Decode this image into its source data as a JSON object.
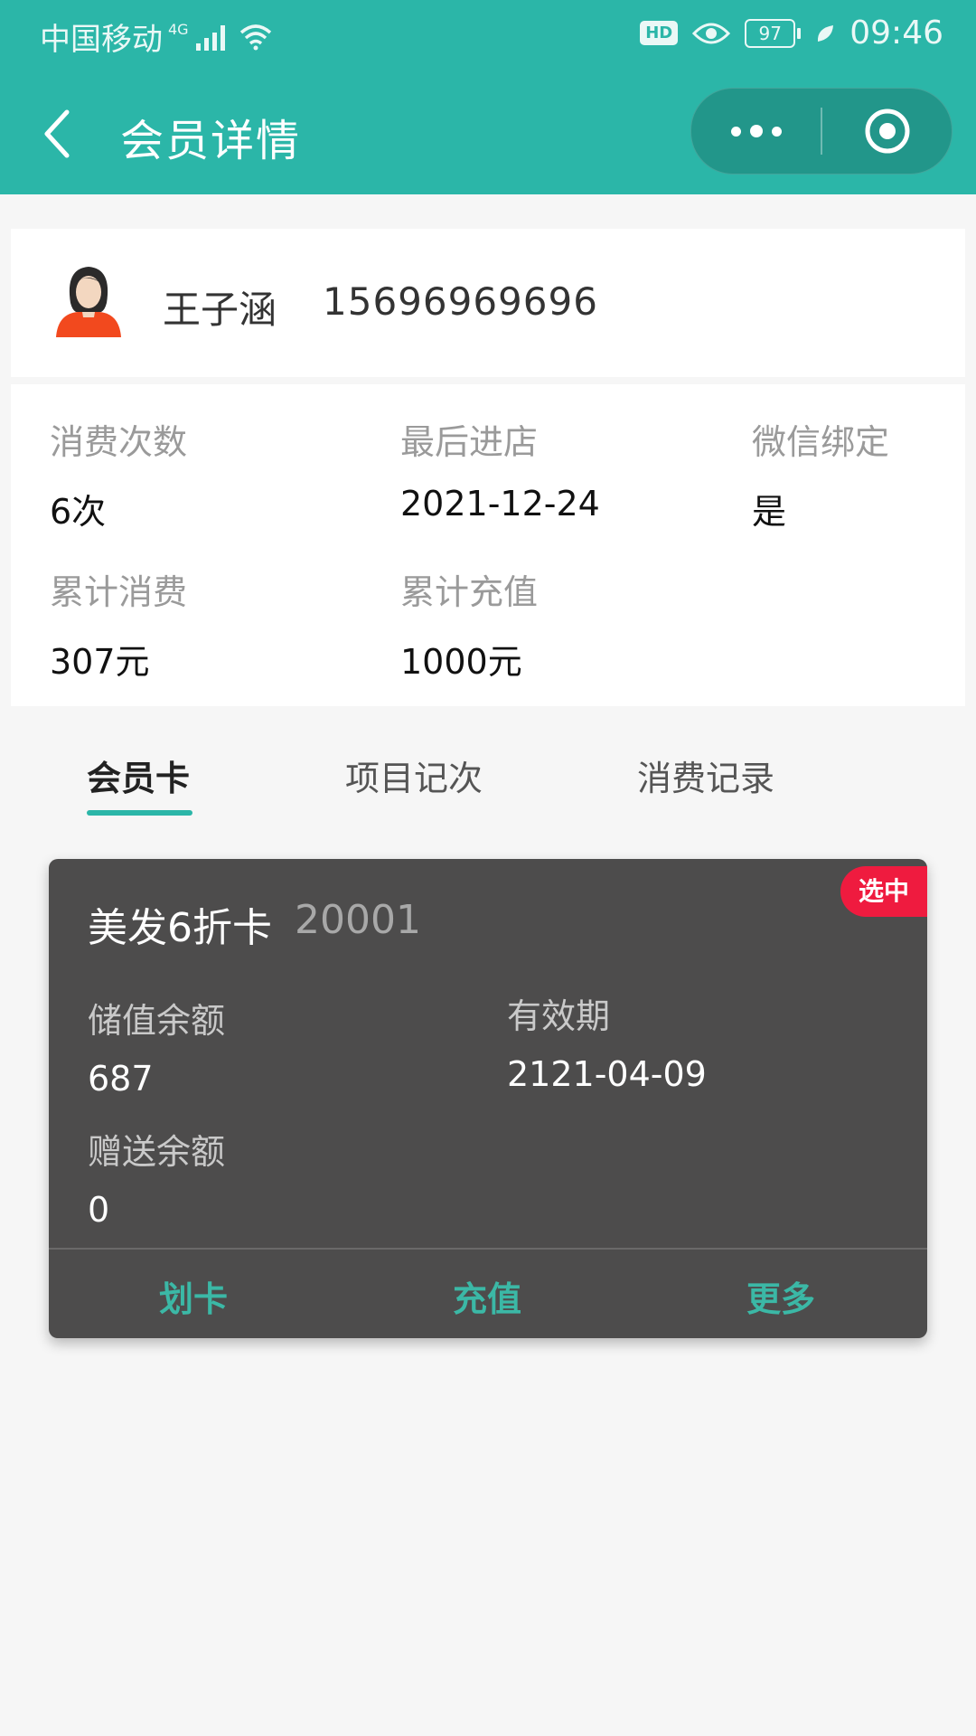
{
  "status_bar": {
    "carrier": "中国移动",
    "network": "4G",
    "hd_badge": "HD",
    "battery": "97",
    "time": "09:46"
  },
  "nav": {
    "title": "会员详情",
    "back_icon": "chevron-left-icon",
    "more_icon": "more-dots-icon",
    "close_icon": "target-close-icon"
  },
  "member": {
    "name": "王子涵",
    "phone": "15696969696"
  },
  "stats": [
    {
      "label": "消费次数",
      "value": "6次"
    },
    {
      "label": "最后进店",
      "value": "2021-12-24"
    },
    {
      "label": "微信绑定",
      "value": "是"
    },
    {
      "label": "累计消费",
      "value": "307元"
    },
    {
      "label": "累计充值",
      "value": "1000元"
    }
  ],
  "tabs": [
    {
      "label": "会员卡",
      "active": true
    },
    {
      "label": "项目记次",
      "active": false
    },
    {
      "label": "消费记录",
      "active": false
    }
  ],
  "card": {
    "title": "美发6折卡",
    "number": "20001",
    "badge": "选中",
    "fields": [
      {
        "label": "储值余额",
        "value": "687"
      },
      {
        "label": "有效期",
        "value": "2121-04-09"
      },
      {
        "label": "赠送余额",
        "value": "0"
      }
    ],
    "actions": [
      "划卡",
      "充值",
      "更多"
    ]
  },
  "colors": {
    "brand": "#2bb6a8",
    "card_bg": "#4d4c4c",
    "badge": "#ef1b3f",
    "action_text": "#3bb8a6"
  }
}
